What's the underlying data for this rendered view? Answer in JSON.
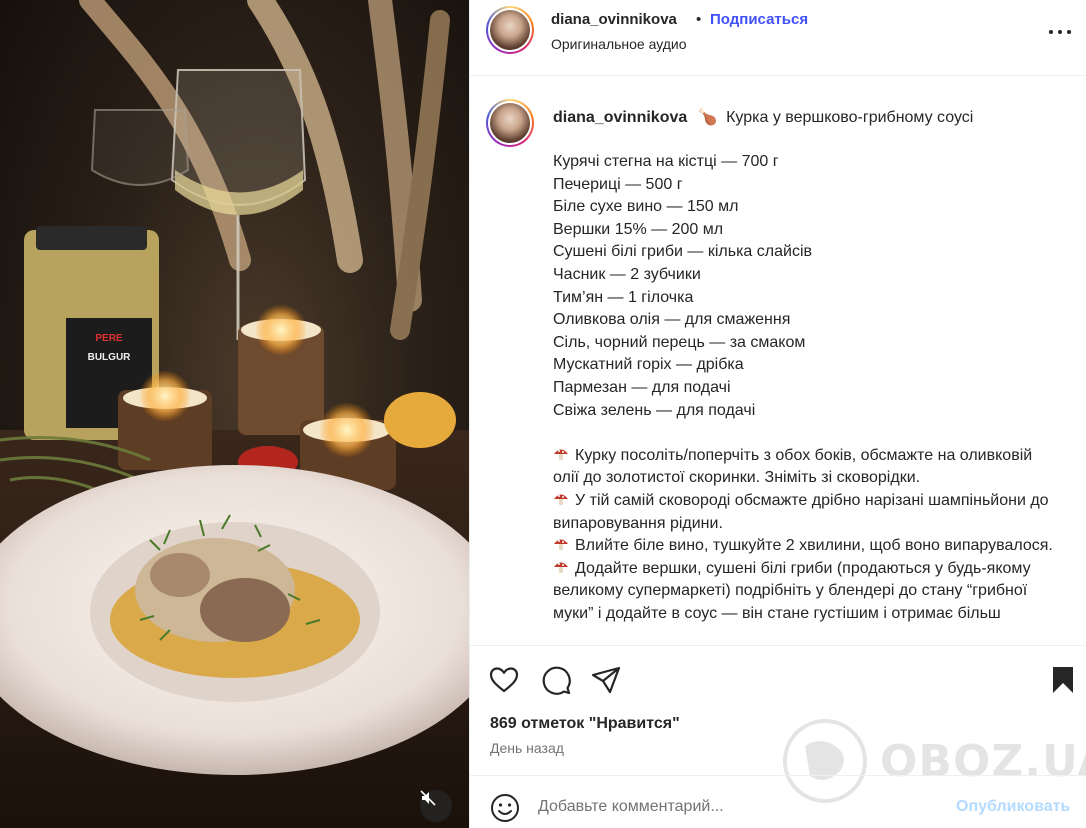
{
  "post": {
    "username": "diana_ovinnikova",
    "follow_label": "Подписаться",
    "separator": "•",
    "audio_label": "Оригинальное аудио",
    "title_emoji": "🍗",
    "title": "Курка у вершково-грибному соусі",
    "ingredients": [
      "Курячі стегна на кістці — 700 г",
      "Печериці — 500 г",
      "Біле сухе вино — 150 мл",
      "Вершки 15% — 200 мл",
      "Сушені білі гриби — кілька слайсів",
      "Часник — 2 зубчики",
      "Тим’ян — 1 гілочка",
      "Оливкова олія — для смаження",
      "Сіль, чорний перець — за смаком",
      "Мускатний горіх — дрібка",
      "Пармезан — для подачі",
      "Свіжа зелень — для подачі"
    ],
    "steps": [
      "Курку посоліть/поперчіть з обох боків, обсмажте на оливковій олії до золотистої скоринки. Зніміть зі сковорідки.",
      "У тій самій сковороді обсмажте дрібно нарізані шампіньйони до випаровування рідини.",
      "Влийте біле вино, тушкуйте 2 хвилини, щоб воно випарувалося.",
      "Додайте вершки, сушені білі гриби (продаються у будь-якому великому супермаркеті) подрібніть у блендері до стану “грибної муки” і додайте в соус — він стане густішим і отримає більш"
    ],
    "step_icon": "mushroom-icon",
    "likes": "869 отметок \"Нравится\"",
    "date": "День назад"
  },
  "media": {
    "jar_brand": "PERE",
    "jar_label": "BULGUR",
    "mute_icon": "speaker-muted-icon"
  },
  "actions": {
    "icons": [
      "heart-icon",
      "comment-icon",
      "share-icon",
      "bookmark-icon"
    ]
  },
  "comment": {
    "placeholder": "Добавьте комментарий...",
    "publish_label": "Опубликовать"
  },
  "watermark": {
    "text": "OBOZ.UA"
  },
  "colors": {
    "link_blue": "#4150f7",
    "publish_disabled": "#b3dbff",
    "text": "#262626",
    "muted": "#737373"
  }
}
